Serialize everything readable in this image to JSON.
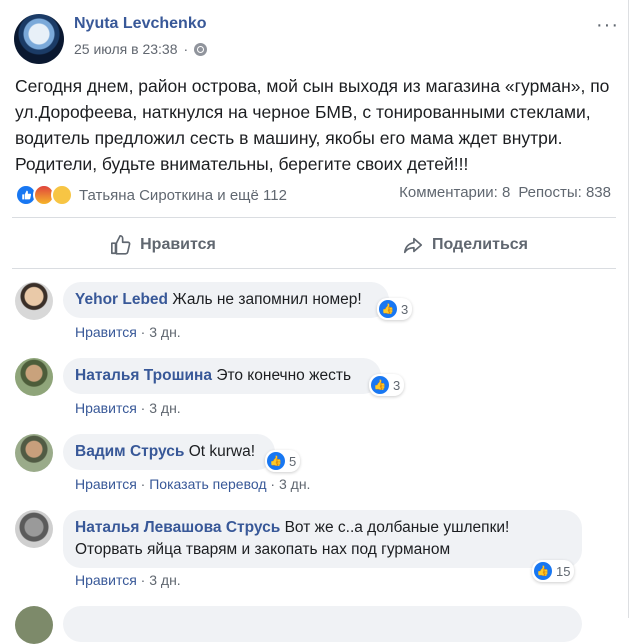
{
  "post": {
    "author": "Nyuta Levchenko",
    "time": "25 июля в 23:38",
    "more": "···",
    "text": "Сегодня днем, район острова, мой сын выходя из магазина «гурман», по ул.Дорофеева, наткнулся на черное БМВ, с тонированными стеклами, водитель предложил сесть в машину, якобы его мама ждет внутри. Родители, будьте внимательны, берегите своих детей!!!",
    "reactions_text": "Татьяна Сироткина и ещё 112",
    "comments_count": "Комментарии: 8",
    "shares_count": "Репосты: 838",
    "like_label": "Нравится",
    "share_label": "Поделиться"
  },
  "comments": [
    {
      "name": "Yehor Lebed",
      "text": "Жаль не запомнил номер!",
      "likes": "3",
      "like": "Нравится",
      "sep": "·",
      "time": "3 дн."
    },
    {
      "name": "Наталья Трошина",
      "text": "Это конечно жесть",
      "likes": "3",
      "like": "Нравится",
      "sep": "·",
      "time": "3 дн."
    },
    {
      "name": "Вадим Струсь",
      "text": "Ot kurwa!",
      "likes": "5",
      "like": "Нравится",
      "sep": "·",
      "translate": "Показать перевод",
      "time": "3 дн."
    },
    {
      "name": "Наталья Левашова Струсь",
      "text": "Вот же с..а долбаные ушлепки! Оторвать яйца тварям и закопать нах под гурманом",
      "likes": "15",
      "like": "Нравится",
      "sep": "·",
      "time": "3 дн."
    }
  ],
  "colors": {
    "link": "#385898",
    "brand": "#1877f2",
    "muted": "#606770",
    "bubble": "#f0f2f5"
  },
  "icons": [
    "globe-icon",
    "more-icon",
    "like-reaction-icon",
    "angry-reaction-icon",
    "wow-reaction-icon",
    "thumbs-up-icon",
    "share-arrow-icon"
  ]
}
